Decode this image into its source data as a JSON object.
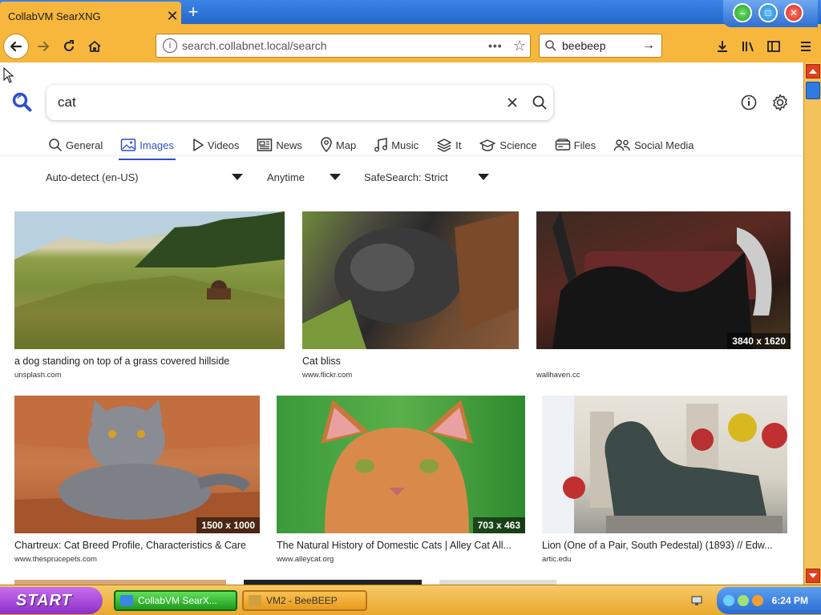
{
  "browser": {
    "tab_title": "CollabVM SearXNG",
    "url_host": "search.collabnet.local",
    "url_path": "/search",
    "search_engine_query": "beebeep"
  },
  "search": {
    "query": "cat"
  },
  "categories": [
    {
      "label": "General",
      "icon": "search-icon",
      "active": false
    },
    {
      "label": "Images",
      "icon": "image-icon",
      "active": true
    },
    {
      "label": "Videos",
      "icon": "play-icon",
      "active": false
    },
    {
      "label": "News",
      "icon": "newspaper-icon",
      "active": false
    },
    {
      "label": "Map",
      "icon": "map-pin-icon",
      "active": false
    },
    {
      "label": "Music",
      "icon": "music-note-icon",
      "active": false
    },
    {
      "label": "It",
      "icon": "layers-icon",
      "active": false
    },
    {
      "label": "Science",
      "icon": "graduation-cap-icon",
      "active": false
    },
    {
      "label": "Files",
      "icon": "drive-icon",
      "active": false
    },
    {
      "label": "Social Media",
      "icon": "people-icon",
      "active": false
    }
  ],
  "filters": {
    "language": "Auto-detect (en-US)",
    "time_range": "Anytime",
    "safesearch": "SafeSearch: Strict"
  },
  "results": [
    {
      "title": "a dog standing on top of a grass covered hillside",
      "source": "unsplash.com",
      "dimensions": ""
    },
    {
      "title": "Cat bliss",
      "source": "www.flickr.com",
      "dimensions": ""
    },
    {
      "title": "",
      "source": "wallhaven.cc",
      "dimensions": "3840 x 1620"
    },
    {
      "title": "Chartreux: Cat Breed Profile, Characteristics & Care",
      "source": "www.thesprucepets.com",
      "dimensions": "1500 x 1000"
    },
    {
      "title": "The Natural History of Domestic Cats | Alley Cat All...",
      "source": "www.alleycat.org",
      "dimensions": "703 x 463"
    },
    {
      "title": "Lion (One of a Pair, South Pedestal) (1893) // Edw...",
      "source": "artic.edu",
      "dimensions": ""
    }
  ],
  "taskbar": {
    "start_label": "START",
    "tasks": [
      "CollabVM SearX...",
      "VM2 - BeeBEEP"
    ],
    "clock": "6:24 PM"
  },
  "colors": {
    "accent": "#3050c8",
    "chrome": "#f6b73c",
    "titlebar": "#3c84e6"
  }
}
